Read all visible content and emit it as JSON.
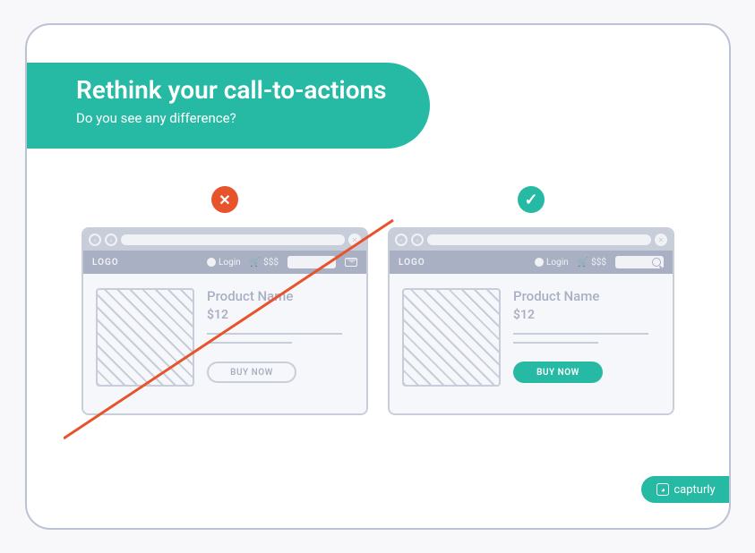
{
  "header": {
    "title": "Rethink your call-to-actions",
    "subtitle": "Do you see any difference?"
  },
  "mock_left": {
    "logo": "LOGO",
    "login": "Login",
    "cart": "$$$",
    "product_name": "Product Name",
    "price": "$12",
    "cta": "BUY NOW"
  },
  "mock_right": {
    "logo": "LOGO",
    "login": "Login",
    "cart": "$$$",
    "product_name": "Product Name",
    "price": "$12",
    "cta": "BUY NOW"
  },
  "brand": "capturly",
  "colors": {
    "teal": "#26b9a4",
    "red": "#e7532a",
    "grey": "#c8cdda"
  }
}
